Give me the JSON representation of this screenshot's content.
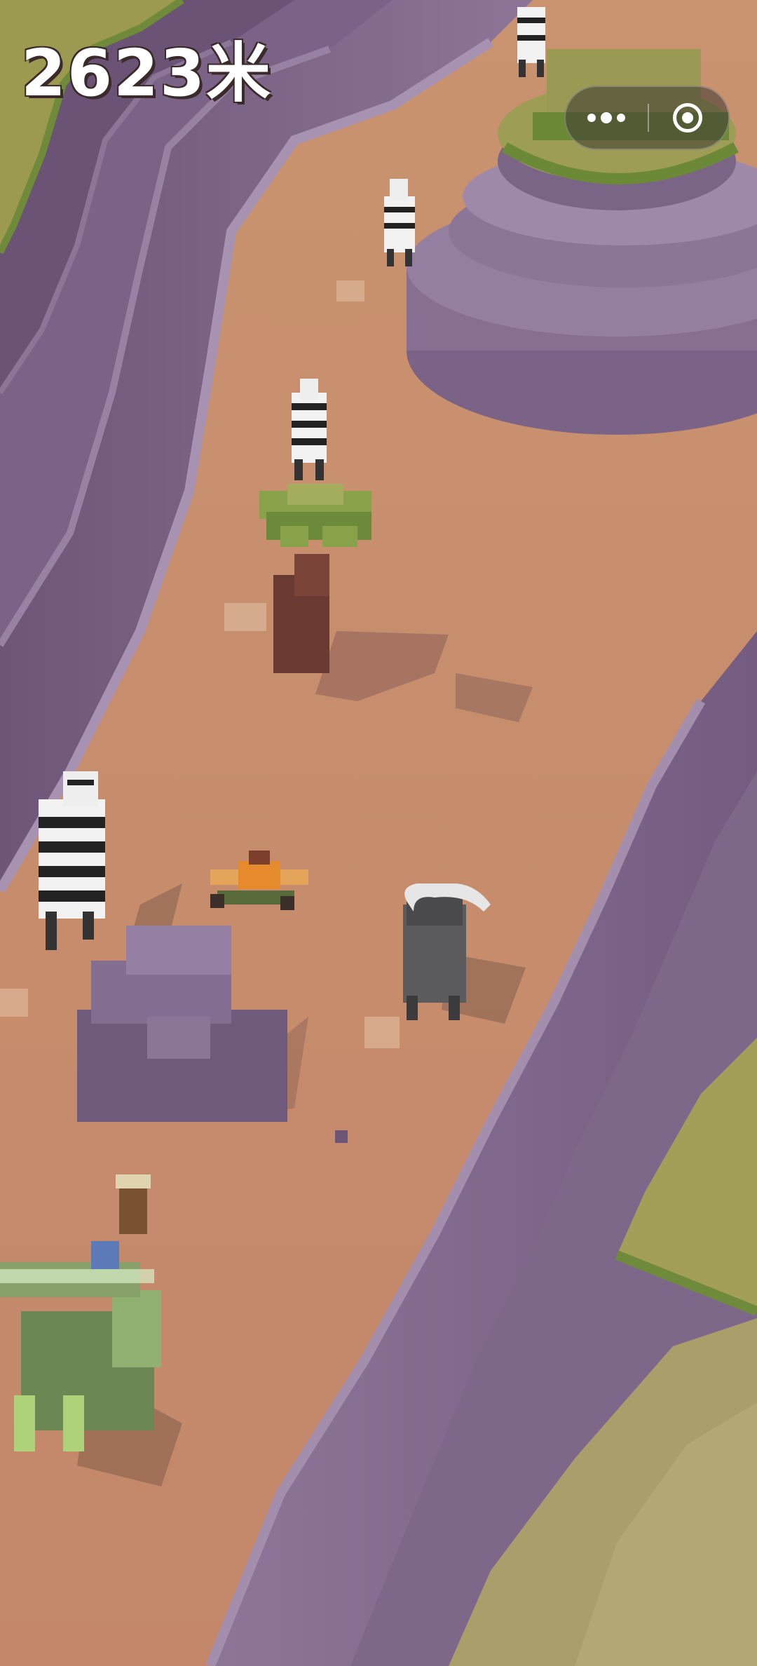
{
  "hud": {
    "distance": "2623米"
  },
  "menu_capsule": {
    "more_icon": "more-dots-icon",
    "close_icon": "target-circle-icon"
  },
  "scene": {
    "ground_color": "#c98f6a",
    "cliff_color": "#7d6688",
    "grass_color": "#9a9a52",
    "entities": [
      "zebra",
      "zebra",
      "zebra",
      "zebra",
      "cape-buffalo",
      "cowboy-rider",
      "acacia-tree",
      "rock",
      "plateau",
      "green-elephant",
      "elephant-rider"
    ]
  }
}
